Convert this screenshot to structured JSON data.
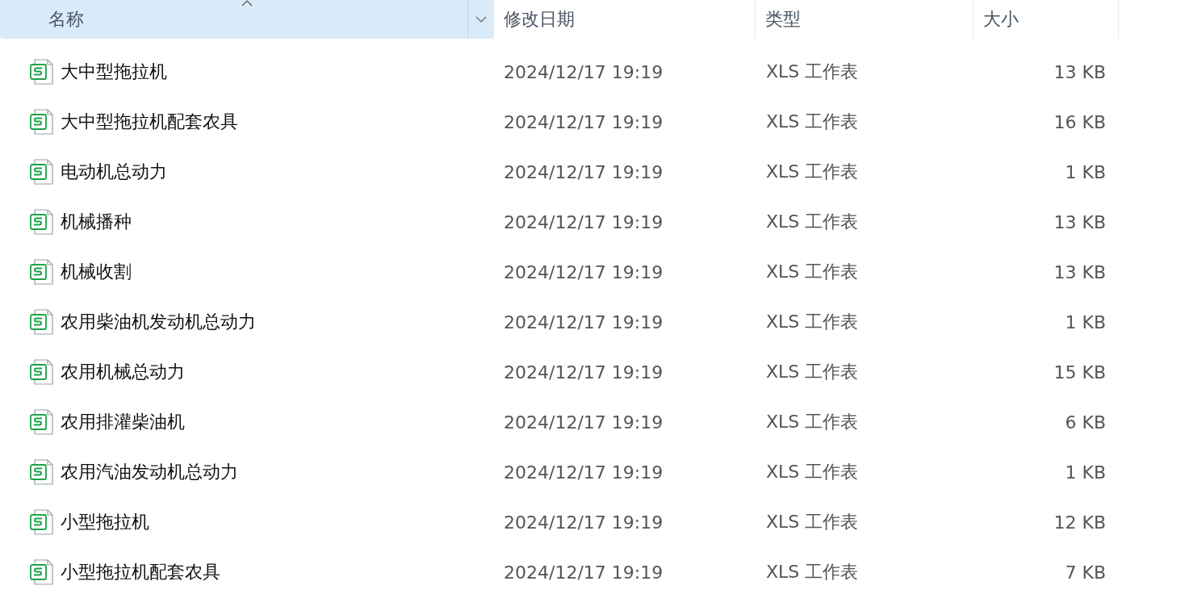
{
  "columns": [
    {
      "label": "名称",
      "selected": true,
      "sorted": true
    },
    {
      "label": "修改日期",
      "selected": false,
      "sorted": false
    },
    {
      "label": "类型",
      "selected": false,
      "sorted": false
    },
    {
      "label": "大小",
      "selected": false,
      "sorted": false
    }
  ],
  "rows": [
    {
      "name": "大中型拖拉机",
      "modified": "2024/12/17 19:19",
      "type": "XLS 工作表",
      "size": "13 KB"
    },
    {
      "name": "大中型拖拉机配套农具",
      "modified": "2024/12/17 19:19",
      "type": "XLS 工作表",
      "size": "16 KB"
    },
    {
      "name": "电动机总动力",
      "modified": "2024/12/17 19:19",
      "type": "XLS 工作表",
      "size": "1 KB"
    },
    {
      "name": "机械播种",
      "modified": "2024/12/17 19:19",
      "type": "XLS 工作表",
      "size": "13 KB"
    },
    {
      "name": "机械收割",
      "modified": "2024/12/17 19:19",
      "type": "XLS 工作表",
      "size": "13 KB"
    },
    {
      "name": "农用柴油机发动机总动力",
      "modified": "2024/12/17 19:19",
      "type": "XLS 工作表",
      "size": "1 KB"
    },
    {
      "name": "农用机械总动力",
      "modified": "2024/12/17 19:19",
      "type": "XLS 工作表",
      "size": "15 KB"
    },
    {
      "name": "农用排灌柴油机",
      "modified": "2024/12/17 19:19",
      "type": "XLS 工作表",
      "size": "6 KB"
    },
    {
      "name": "农用汽油发动机总动力",
      "modified": "2024/12/17 19:19",
      "type": "XLS 工作表",
      "size": "1 KB"
    },
    {
      "name": "小型拖拉机",
      "modified": "2024/12/17 19:19",
      "type": "XLS 工作表",
      "size": "12 KB"
    },
    {
      "name": "小型拖拉机配套农具",
      "modified": "2024/12/17 19:19",
      "type": "XLS 工作表",
      "size": "7 KB"
    }
  ]
}
